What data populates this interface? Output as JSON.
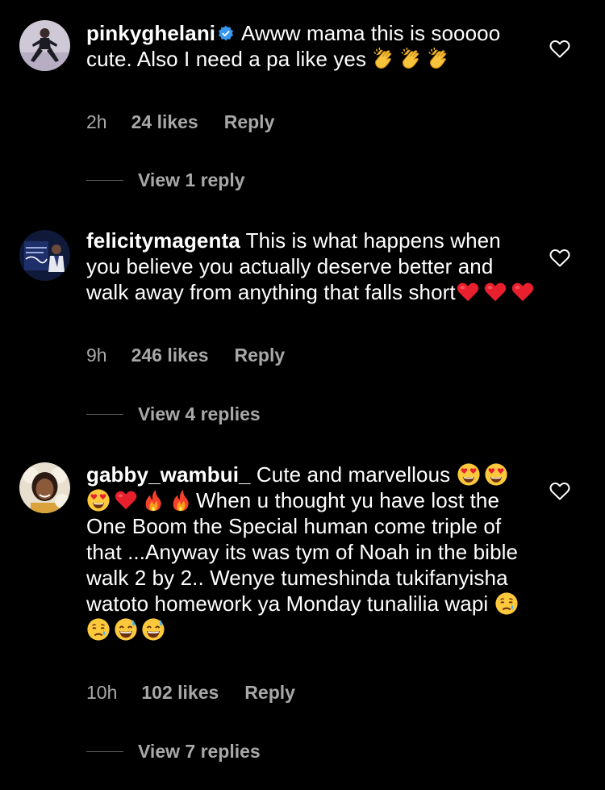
{
  "comments": [
    {
      "username": "pinkyghelani",
      "verified": true,
      "text_parts": [
        "Awww mama this is sooooo cute. Also I need a pa like yes "
      ],
      "emojis": [
        "clapping-hands",
        "clapping-hands",
        "clapping-hands"
      ],
      "time": "2h",
      "likes": "24 likes",
      "reply_label": "Reply",
      "view_replies": "View 1 reply"
    },
    {
      "username": "felicitymagenta",
      "verified": false,
      "text_parts": [
        "This is what happens when you believe you actually deserve better and walk away from anything that falls short"
      ],
      "emojis": [
        "red-heart",
        "red-heart",
        "red-heart"
      ],
      "time": "9h",
      "likes": "246 likes",
      "reply_label": "Reply",
      "view_replies": "View 4 replies"
    },
    {
      "username": "gabby_wambui_",
      "verified": false,
      "text_parts": [
        "Cute and marvellous ",
        "When u thought yu have lost the One Boom the Special human come triple of that ...Anyway its was tym of Noah in the bible walk 2 by 2.. Wenye tumeshinda tukifanyisha watoto homework ya Monday tunalilia wapi "
      ],
      "emojis_1": [
        "heart-eyes",
        "heart-eyes",
        "heart-eyes",
        "red-heart",
        "fire",
        "fire"
      ],
      "emojis_2": [
        "crying-face",
        "crying-face",
        "sweat-smile",
        "sweat-smile"
      ],
      "time": "10h",
      "likes": "102 likes",
      "reply_label": "Reply",
      "view_replies": "View 7 replies"
    }
  ],
  "colors": {
    "background": "#000000",
    "text": "#ffffff",
    "secondary": "#a8a8a8",
    "verified": "#3897f0",
    "heart_outline": "#ffffff"
  }
}
